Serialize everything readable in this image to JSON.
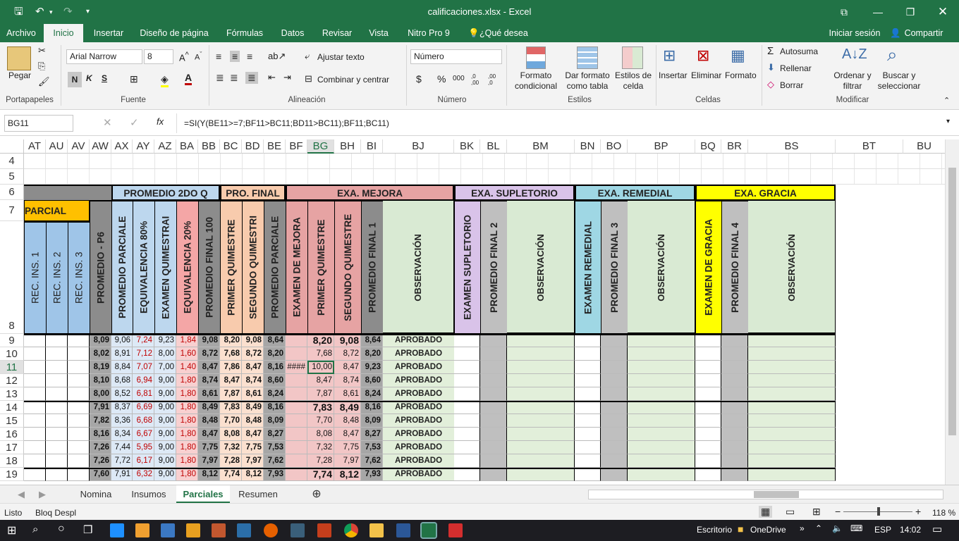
{
  "window": {
    "title": "calificaciones.xlsx - Excel"
  },
  "ribbon_tabs": [
    "Archivo",
    "Inicio",
    "Insertar",
    "Diseño de página",
    "Fórmulas",
    "Datos",
    "Revisar",
    "Vista",
    "Nitro Pro 9",
    "¿Qué desea hacer?"
  ],
  "account": {
    "signin": "Iniciar sesión",
    "share": "Compartir"
  },
  "clipboard": {
    "paste": "Pegar",
    "group": "Portapapeles"
  },
  "font": {
    "name": "Arial Narrow",
    "size": "8",
    "group": "Fuente",
    "bold": "N",
    "italic": "K",
    "underline": "S"
  },
  "alignment": {
    "wrap": "Ajustar texto",
    "merge": "Combinar y centrar",
    "group": "Alineación"
  },
  "number": {
    "format": "Número",
    "group": "Número",
    "currency": "$",
    "percent": "%",
    "thousands": "000",
    "inc": ",0 ,00",
    "dec": ",00 ,0"
  },
  "styles": {
    "cond": "Formato condicional",
    "table": "Dar formato como tabla",
    "cell": "Estilos de celda",
    "group": "Estilos"
  },
  "cells": {
    "insert": "Insertar",
    "delete": "Eliminar",
    "format": "Formato",
    "group": "Celdas"
  },
  "editing": {
    "autosum": "Autosuma",
    "fill": "Rellenar",
    "clear": "Borrar",
    "sort": "Ordenar y filtrar",
    "find": "Buscar y seleccionar",
    "group": "Modificar"
  },
  "formula_bar": {
    "name_box": "BG11",
    "fx": "fx",
    "formula": "=SI(Y(BE11>=7;BF11>BC11;BD11>BC11);BF11;BC11)"
  },
  "columns": [
    "AT",
    "AU",
    "AV",
    "AW",
    "AX",
    "AY",
    "AZ",
    "BA",
    "BB",
    "BC",
    "BD",
    "BE",
    "BF",
    "BG",
    "BH",
    "BI",
    "BJ",
    "BK",
    "BL",
    "BM",
    "BN",
    "BO",
    "BP",
    "BQ",
    "BR",
    "BS",
    "BT",
    "BU"
  ],
  "rows": [
    "4",
    "5",
    "6",
    "7",
    "8",
    "9",
    "10",
    "11",
    "12",
    "13",
    "14",
    "15",
    "16",
    "17",
    "18",
    "19"
  ],
  "group_headers": {
    "parcial": "PARCIAL",
    "promedio2": "PROMEDIO 2DO Q",
    "profinal": "PRO. FINAL",
    "mejora": "EXA. MEJORA",
    "supletorio": "EXA. SUPLETORIO",
    "remedial": "EXA. REMEDIAL",
    "gracia": "EXA. GRACIA"
  },
  "vertical_headers": [
    "REC. INS. 1",
    "REC. INS. 2",
    "REC. INS. 3",
    "PROMEDIO - P6",
    "PROMEDIO PARCIALE",
    "EQUIVALENCIA 80%",
    "EXAMEN QUIMESTRAI",
    "EQUIVALENCIA 20%",
    "PROMEDIO FINAL 100",
    "PRIMER QUIMESTRE",
    "SEGUNDO QUIMESTRI",
    "PROMEDIO PARCIALE",
    "EXAMEN DE MEJORA",
    "PRIMER QUIMESTRE",
    "SEGUNDO QUIMESTRE",
    "PROMEDIO FINAL 1",
    "OBSERVACIÓN",
    "EXAMEN SUPLETORIO",
    "PROMEDIO FINAL 2",
    "OBSERVACIÓN",
    "EXAMEN REMEDIAL",
    "PROMEDIO FINAL 3",
    "OBSERVACIÓN",
    "EXAMEN DE GRACIA",
    "PROMEDIO FINAL 4",
    "OBSERVACIÓN"
  ],
  "data_rows": [
    {
      "AW": "8,09",
      "AX": "9,06",
      "AY": "7,24",
      "AZ": "9,23",
      "BA": "1,84",
      "BB": "9,08",
      "BC": "8,20",
      "BD": "9,08",
      "BE": "8,64",
      "BF": "",
      "BG": "8,20",
      "BH": "9,08",
      "BI": "8,64",
      "BJ": "APROBADO"
    },
    {
      "AW": "8,02",
      "AX": "8,91",
      "AY": "7,12",
      "AZ": "8,00",
      "BA": "1,60",
      "BB": "8,72",
      "BC": "7,68",
      "BD": "8,72",
      "BE": "8,20",
      "BF": "",
      "BG": "7,68",
      "BH": "8,72",
      "BI": "8,20",
      "BJ": "APROBADO"
    },
    {
      "AW": "8,19",
      "AX": "8,84",
      "AY": "7,07",
      "AZ": "7,00",
      "BA": "1,40",
      "BB": "8,47",
      "BC": "7,86",
      "BD": "8,47",
      "BE": "8,16",
      "BF": "####",
      "BG": "10,00",
      "BH": "8,47",
      "BI": "9,23",
      "BJ": "APROBADO"
    },
    {
      "AW": "8,10",
      "AX": "8,68",
      "AY": "6,94",
      "AZ": "9,00",
      "BA": "1,80",
      "BB": "8,74",
      "BC": "8,47",
      "BD": "8,74",
      "BE": "8,60",
      "BF": "",
      "BG": "8,47",
      "BH": "8,74",
      "BI": "8,60",
      "BJ": "APROBADO"
    },
    {
      "AW": "8,00",
      "AX": "8,52",
      "AY": "6,81",
      "AZ": "9,00",
      "BA": "1,80",
      "BB": "8,61",
      "BC": "7,87",
      "BD": "8,61",
      "BE": "8,24",
      "BF": "",
      "BG": "7,87",
      "BH": "8,61",
      "BI": "8,24",
      "BJ": "APROBADO"
    },
    {
      "AW": "7,91",
      "AX": "8,37",
      "AY": "6,69",
      "AZ": "9,00",
      "BA": "1,80",
      "BB": "8,49",
      "BC": "7,83",
      "BD": "8,49",
      "BE": "8,16",
      "BF": "",
      "BG": "7,83",
      "BH": "8,49",
      "BI": "8,16",
      "BJ": "APROBADO"
    },
    {
      "AW": "7,82",
      "AX": "8,36",
      "AY": "6,68",
      "AZ": "9,00",
      "BA": "1,80",
      "BB": "8,48",
      "BC": "7,70",
      "BD": "8,48",
      "BE": "8,09",
      "BF": "",
      "BG": "7,70",
      "BH": "8,48",
      "BI": "8,09",
      "BJ": "APROBADO"
    },
    {
      "AW": "8,16",
      "AX": "8,34",
      "AY": "6,67",
      "AZ": "9,00",
      "BA": "1,80",
      "BB": "8,47",
      "BC": "8,08",
      "BD": "8,47",
      "BE": "8,27",
      "BF": "",
      "BG": "8,08",
      "BH": "8,47",
      "BI": "8,27",
      "BJ": "APROBADO"
    },
    {
      "AW": "7,26",
      "AX": "7,44",
      "AY": "5,95",
      "AZ": "9,00",
      "BA": "1,80",
      "BB": "7,75",
      "BC": "7,32",
      "BD": "7,75",
      "BE": "7,53",
      "BF": "",
      "BG": "7,32",
      "BH": "7,75",
      "BI": "7,53",
      "BJ": "APROBADO"
    },
    {
      "AW": "7,26",
      "AX": "7,72",
      "AY": "6,17",
      "AZ": "9,00",
      "BA": "1,80",
      "BB": "7,97",
      "BC": "7,28",
      "BD": "7,97",
      "BE": "7,62",
      "BF": "",
      "BG": "7,28",
      "BH": "7,97",
      "BI": "7,62",
      "BJ": "APROBADO"
    },
    {
      "AW": "7,60",
      "AX": "7,91",
      "AY": "6,32",
      "AZ": "9,00",
      "BA": "1,80",
      "BB": "8,12",
      "BC": "7,74",
      "BD": "8,12",
      "BE": "7,93",
      "BF": "",
      "BG": "7,74",
      "BH": "8,12",
      "BI": "7,93",
      "BJ": "APROBADO"
    }
  ],
  "sheets": [
    "Nomina",
    "Insumos",
    "Parciales",
    "Resumen"
  ],
  "status": {
    "ready": "Listo",
    "scroll": "Bloq Despl",
    "zoom": "118 %"
  },
  "taskbar": {
    "desktop": "Escritorio",
    "onedrive": "OneDrive",
    "lang": "ESP",
    "time": "14:02"
  }
}
